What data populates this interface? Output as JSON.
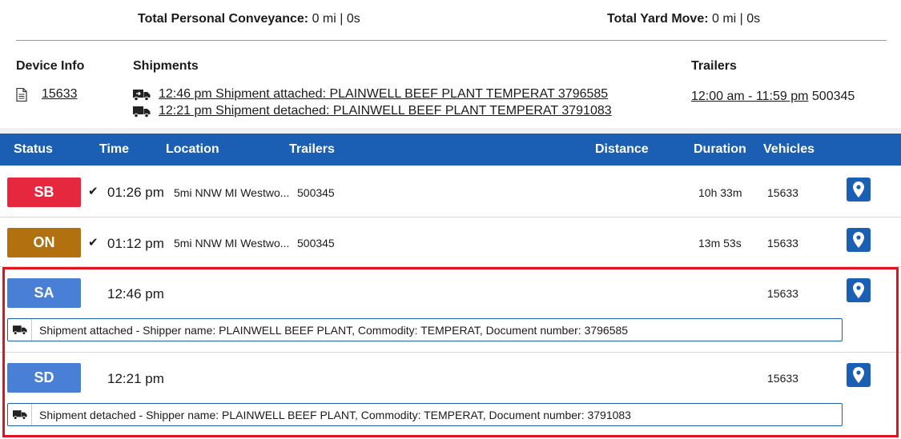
{
  "totals": {
    "personal_conveyance_label": "Total Personal Conveyance:",
    "personal_conveyance_value": "0 mi | 0s",
    "yard_move_label": "Total Yard Move:",
    "yard_move_value": "0 mi | 0s"
  },
  "device_info": {
    "title": "Device Info",
    "device_id": "15633"
  },
  "shipments": {
    "title": "Shipments",
    "items": [
      {
        "text": "12:46 pm Shipment attached: PLAINWELL BEEF PLANT TEMPERAT 3796585"
      },
      {
        "text": "12:21 pm Shipment detached: PLAINWELL BEEF PLANT TEMPERAT 3791083"
      }
    ]
  },
  "trailers": {
    "title": "Trailers",
    "range": "12:00 am - 11:59 pm",
    "id": "500345"
  },
  "table": {
    "headers": {
      "status": "Status",
      "time": "Time",
      "location": "Location",
      "trailers": "Trailers",
      "distance": "Distance",
      "duration": "Duration",
      "vehicles": "Vehicles"
    },
    "rows": [
      {
        "status": "SB",
        "status_color": "#e6283f",
        "time": "01:26 pm",
        "location": "5mi NNW MI Westwo...",
        "trailers": "500345",
        "duration": "10h 33m",
        "vehicle": "15633"
      },
      {
        "status": "ON",
        "status_color": "#b3700f",
        "time": "01:12 pm",
        "location": "5mi NNW MI Westwo...",
        "trailers": "500345",
        "duration": "13m 53s",
        "vehicle": "15633"
      },
      {
        "status": "SA",
        "status_color": "#4a7fd6",
        "time": "12:46 pm",
        "vehicle": "15633",
        "detail": "Shipment attached - Shipper name: PLAINWELL BEEF PLANT, Commodity: TEMPERAT, Document number: 3796585"
      },
      {
        "status": "SD",
        "status_color": "#4a7fd6",
        "time": "12:21 pm",
        "vehicle": "15633",
        "detail": "Shipment detached - Shipper name: PLAINWELL BEEF PLANT, Commodity: TEMPERAT, Document number: 3791083"
      }
    ]
  },
  "icons": {
    "document": "document-icon",
    "truck": "truck-icon",
    "check": "checkmark-icon",
    "pin": "map-pin-icon"
  },
  "colors": {
    "header_blue": "#1a5fb4",
    "highlight_red": "#e0121d"
  }
}
